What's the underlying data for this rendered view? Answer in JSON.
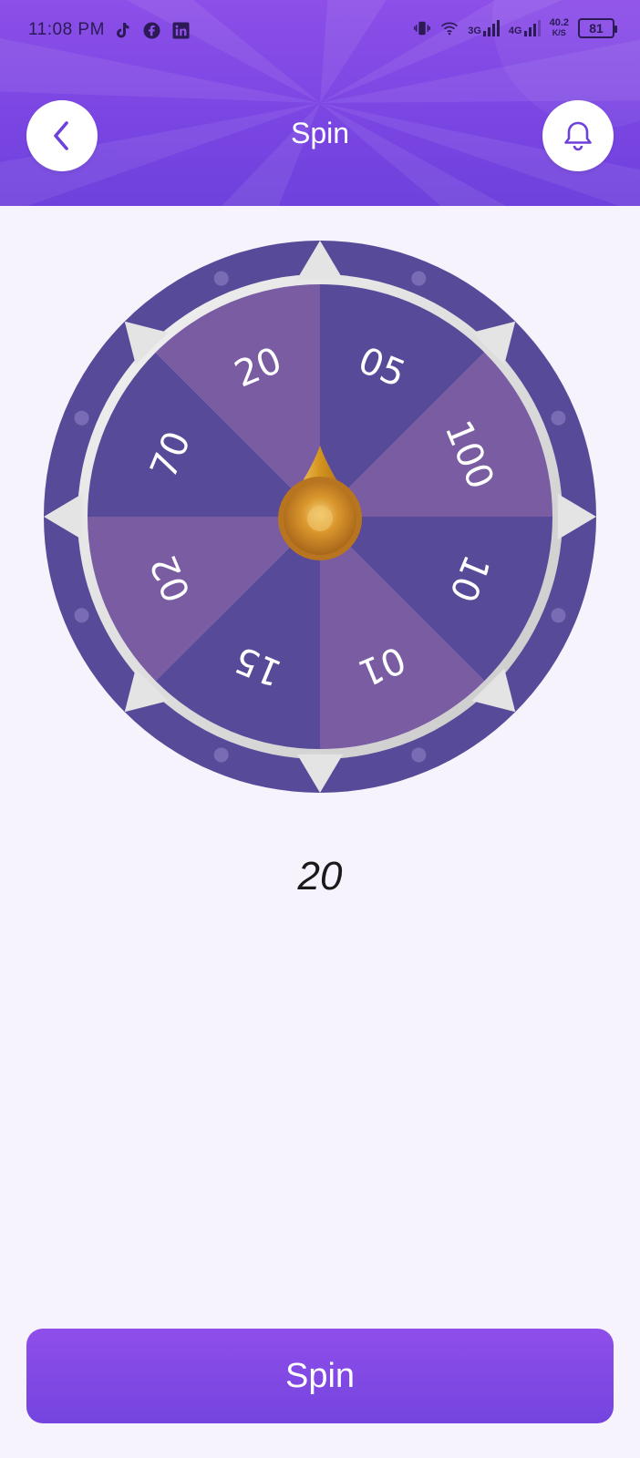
{
  "status_bar": {
    "time": "11:08 PM",
    "left_icons": [
      "tiktok-icon",
      "facebook-icon",
      "linkedin-icon"
    ],
    "right_icons": [
      "vibrate-icon",
      "wifi-icon",
      "signal-3g-icon",
      "signal-4g-icon"
    ],
    "network_1": "3G",
    "network_2": "4G",
    "speed_value": "40.2",
    "speed_unit": "K/S",
    "battery": "81"
  },
  "header": {
    "title": "Spin",
    "back_icon": "chevron-left-icon",
    "bell_icon": "bell-icon",
    "gradient_top": "#8d4fe8",
    "gradient_bottom": "#6f41dc"
  },
  "wheel": {
    "segments": [
      "05",
      "100",
      "10",
      "01",
      "15",
      "02",
      "70",
      "20"
    ],
    "color_dark": "#574a98",
    "color_light": "#7a5ca3",
    "rim_color": "#574a98",
    "pointer_color": "#e2a93a"
  },
  "result": {
    "value": "20"
  },
  "spin_button": {
    "label": "Spin"
  }
}
